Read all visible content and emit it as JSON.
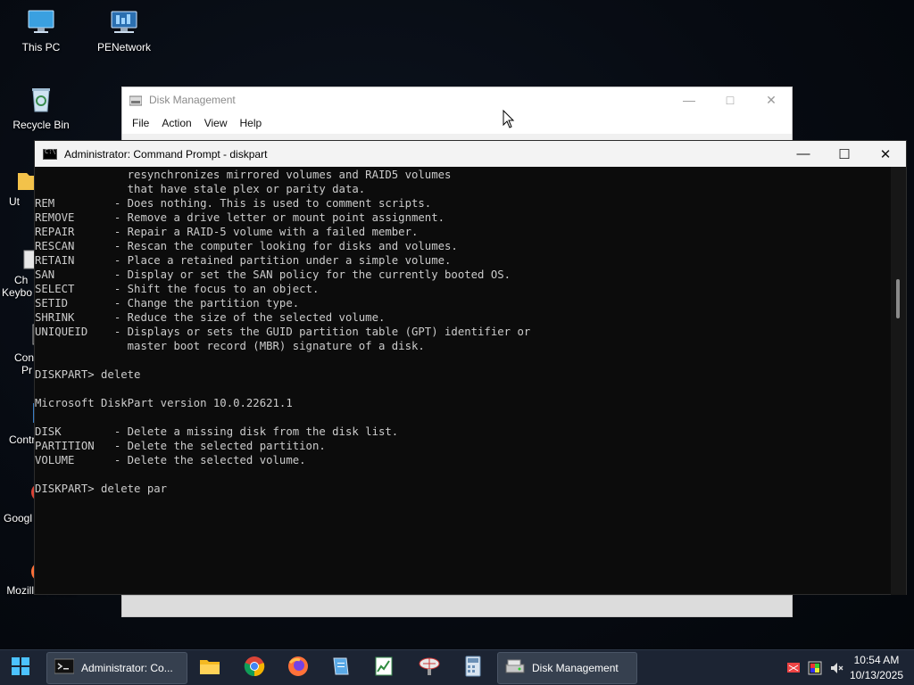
{
  "desktop": {
    "icons": [
      {
        "label": "This PC"
      },
      {
        "label": "PENetwork"
      },
      {
        "label": "Recycle Bin"
      },
      {
        "label": "Ut"
      },
      {
        "label": "Ch"
      },
      {
        "label": "Keybo"
      },
      {
        "label": "Con"
      },
      {
        "label": "Pr"
      },
      {
        "label": "Contr"
      },
      {
        "label": "Googl"
      },
      {
        "label": "Mozilla Firefox"
      }
    ]
  },
  "disk_management": {
    "title": "Disk Management",
    "menu": [
      "File",
      "Action",
      "View",
      "Help"
    ]
  },
  "cmd": {
    "title": "Administrator: Command Prompt - diskpart",
    "lines": [
      "              resynchronizes mirrored volumes and RAID5 volumes",
      "              that have stale plex or parity data.",
      "REM         - Does nothing. This is used to comment scripts.",
      "REMOVE      - Remove a drive letter or mount point assignment.",
      "REPAIR      - Repair a RAID-5 volume with a failed member.",
      "RESCAN      - Rescan the computer looking for disks and volumes.",
      "RETAIN      - Place a retained partition under a simple volume.",
      "SAN         - Display or set the SAN policy for the currently booted OS.",
      "SELECT      - Shift the focus to an object.",
      "SETID       - Change the partition type.",
      "SHRINK      - Reduce the size of the selected volume.",
      "UNIQUEID    - Displays or sets the GUID partition table (GPT) identifier or",
      "              master boot record (MBR) signature of a disk.",
      "",
      "DISKPART> delete",
      "",
      "Microsoft DiskPart version 10.0.22621.1",
      "",
      "DISK        - Delete a missing disk from the disk list.",
      "PARTITION   - Delete the selected partition.",
      "VOLUME      - Delete the selected volume.",
      "",
      "DISKPART> delete par"
    ]
  },
  "taskbar": {
    "cmd_window_label": "Administrator: Co...",
    "dm_window_label": "Disk Management",
    "clock_time": "10:54 AM",
    "clock_date": "10/13/2025"
  }
}
